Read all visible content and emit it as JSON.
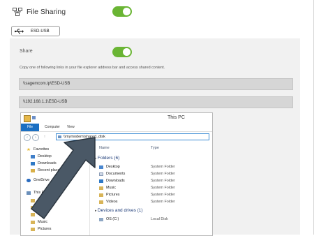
{
  "file_sharing": {
    "title": "File Sharing",
    "enabled": true,
    "icon": "network-share-icon"
  },
  "device_tab": {
    "label": "ESD-USB",
    "icon": "usb-icon"
  },
  "share": {
    "label": "Share",
    "enabled": true,
    "description": "Copy one of following links in your file explorer address bar and access shared content.",
    "links": [
      "\\\\sagemcom.ip\\ESD-USB",
      "\\\\192.168.1.1\\ESD-USB"
    ]
  },
  "explorer": {
    "window_title": "This PC",
    "ribbon_tabs": [
      "File",
      "Computer",
      "View"
    ],
    "address": "\\\\mymodem\\shared_disk",
    "columns": {
      "name": "Name",
      "type": "Type"
    },
    "nav": {
      "favorites": "Favorites",
      "favorites_items": [
        "Desktop",
        "Downloads",
        "Recent places"
      ],
      "onedrive": "OneDrive",
      "this_pc": "This PC",
      "this_pc_items": [
        "D",
        "D",
        "D",
        "Music",
        "Pictures"
      ]
    },
    "folders_group": "Folders (6)",
    "folders": [
      {
        "name": "Desktop",
        "type": "System Folder"
      },
      {
        "name": "Documents",
        "type": "System Folder"
      },
      {
        "name": "Downloads",
        "type": "System Folder"
      },
      {
        "name": "Music",
        "type": "System Folder"
      },
      {
        "name": "Pictures",
        "type": "System Folder"
      },
      {
        "name": "Videos",
        "type": "System Folder"
      }
    ],
    "devices_group": "Devices and drives (1)",
    "devices": [
      {
        "name": "OS (C:)",
        "type": "Local Disk"
      }
    ]
  },
  "colors": {
    "toggle_on": "#6ab534",
    "file_tab": "#1a6fc2",
    "panel_bg": "#f1f1f1",
    "arrow": "#4a5866"
  }
}
